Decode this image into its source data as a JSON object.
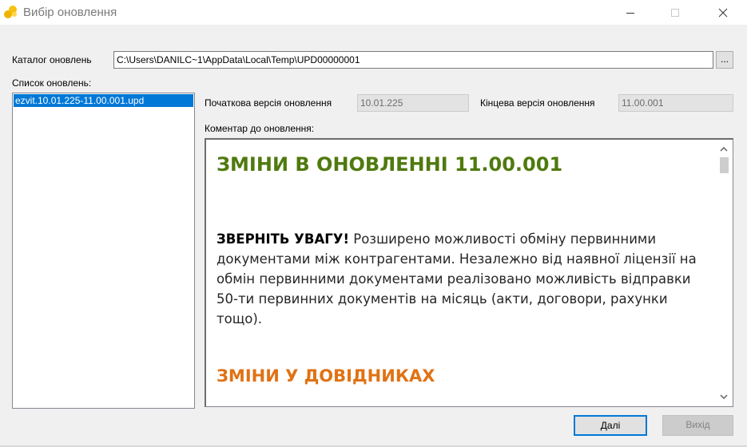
{
  "window": {
    "title": "Вибір оновлення"
  },
  "catalog": {
    "label": "Каталог оновлень",
    "value": "C:\\Users\\DANILC~1\\AppData\\Local\\Temp\\UPD00000001",
    "browse_label": "..."
  },
  "update_list": {
    "label": "Список оновлень:",
    "items": [
      "ezvit.10.01.225-11.00.001.upd"
    ]
  },
  "versions": {
    "start_label": "Початкова версія оновлення",
    "start_value": "10.01.225",
    "end_label": "Кінцева версія оновлення",
    "end_value": "11.00.001"
  },
  "comment": {
    "label": "Коментар до оновлення:",
    "heading": "ЗМІНИ В ОНОВЛЕННІ 11.00.001",
    "attention": "ЗВЕРНІТЬ УВАГУ!",
    "paragraph": " Розширено можливості обміну первинними документами між контрагентами. Незалежно від наявної ліцензії на обмін первинними документами реалізовано можливість відправки 50-ти первинних документів на місяць (акти, договори, рахунки тощо).",
    "section_heading": "ЗМІНИ У ДОВІДНИКАХ"
  },
  "buttons": {
    "next": "Далі",
    "exit": "Вихід"
  },
  "colors": {
    "accent": "#0078d7",
    "heading_green": "#4f7a0e",
    "heading_orange": "#e07214"
  }
}
